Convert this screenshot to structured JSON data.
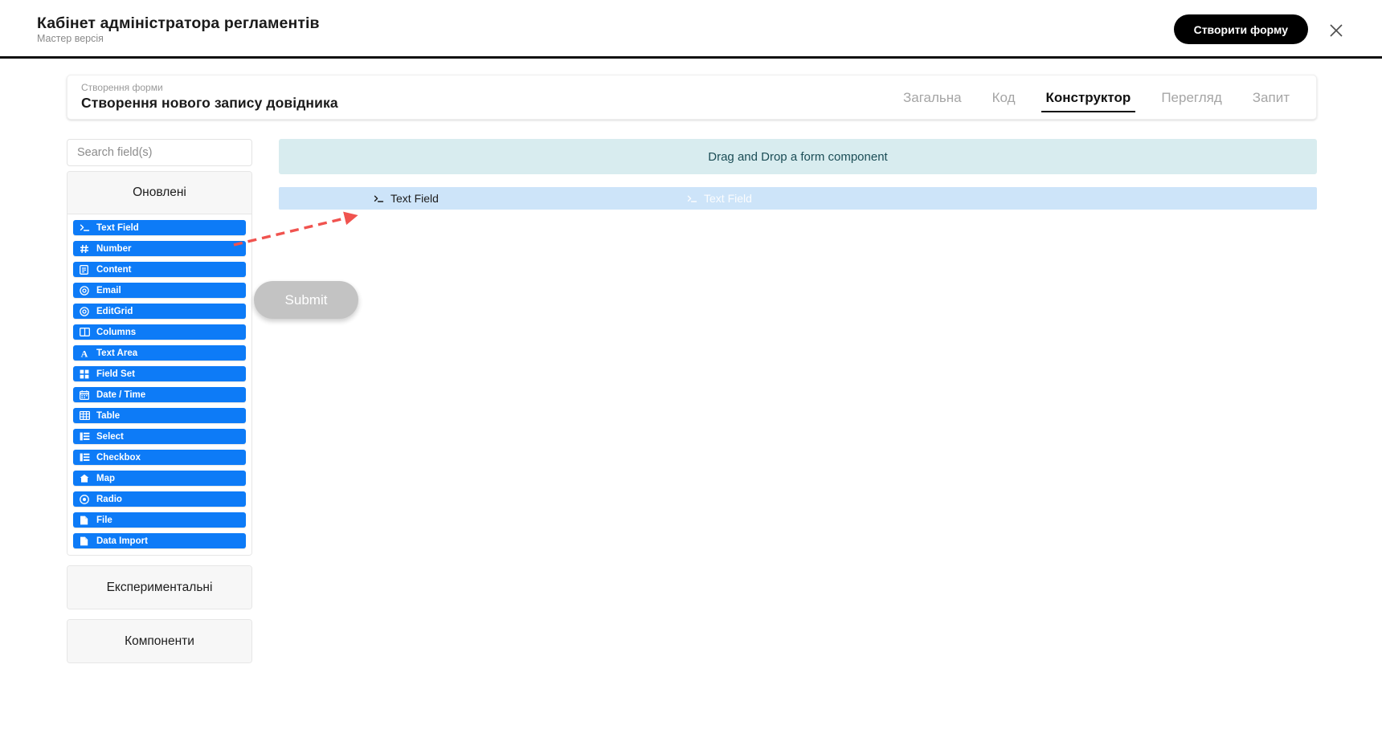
{
  "appbar": {
    "title": "Кабінет адміністратора регламентів",
    "subtitle": "Мастер версія",
    "create_button": "Створити форму",
    "close_icon": "close-icon",
    "accent_color": "#000000"
  },
  "form_header": {
    "eyebrow": "Створення форми",
    "title": "Створення нового запису довідника",
    "tabs": [
      {
        "label": "Загальна",
        "active": false
      },
      {
        "label": "Код",
        "active": false
      },
      {
        "label": "Конструктор",
        "active": true
      },
      {
        "label": "Перегляд",
        "active": false
      },
      {
        "label": "Запит",
        "active": false
      }
    ]
  },
  "palette": {
    "search": {
      "placeholder": "Search field(s)",
      "value": ""
    },
    "sections": [
      {
        "title": "Оновлені",
        "expanded": true
      },
      {
        "title": "Експериментальні",
        "expanded": false
      },
      {
        "title": "Компоненти",
        "expanded": false
      }
    ],
    "components": [
      {
        "label": "Text Field",
        "icon": "terminal-icon"
      },
      {
        "label": "Number",
        "icon": "hash-icon"
      },
      {
        "label": "Content",
        "icon": "content-block-icon"
      },
      {
        "label": "Email",
        "icon": "at-sign-icon"
      },
      {
        "label": "EditGrid",
        "icon": "at-sign-icon"
      },
      {
        "label": "Columns",
        "icon": "columns-icon"
      },
      {
        "label": "Text Area",
        "icon": "letter-a-icon"
      },
      {
        "label": "Field Set",
        "icon": "grid-squares-icon"
      },
      {
        "label": "Date / Time",
        "icon": "calendar-icon"
      },
      {
        "label": "Table",
        "icon": "table-icon"
      },
      {
        "label": "Select",
        "icon": "list-icon"
      },
      {
        "label": "Checkbox",
        "icon": "list-icon"
      },
      {
        "label": "Map",
        "icon": "map-marker-icon"
      },
      {
        "label": "Radio",
        "icon": "radio-dot-icon"
      },
      {
        "label": "File",
        "icon": "file-icon"
      },
      {
        "label": "Data Import",
        "icon": "file-icon"
      }
    ],
    "component_color": "#0d7bf7"
  },
  "canvas": {
    "dropzone_text": "Drag and Drop a form component",
    "dropzone_color": "#d8ecef",
    "row": {
      "label": "Text Field",
      "icon": "terminal-icon",
      "ghost_label": "Text Field",
      "row_color": "#cde4f9"
    }
  },
  "drag_ghost": {
    "label": "Submit",
    "color": "#c2c2c2"
  },
  "annotation": {
    "arrow_color": "#f0534f",
    "style": "dashed-arrow"
  }
}
